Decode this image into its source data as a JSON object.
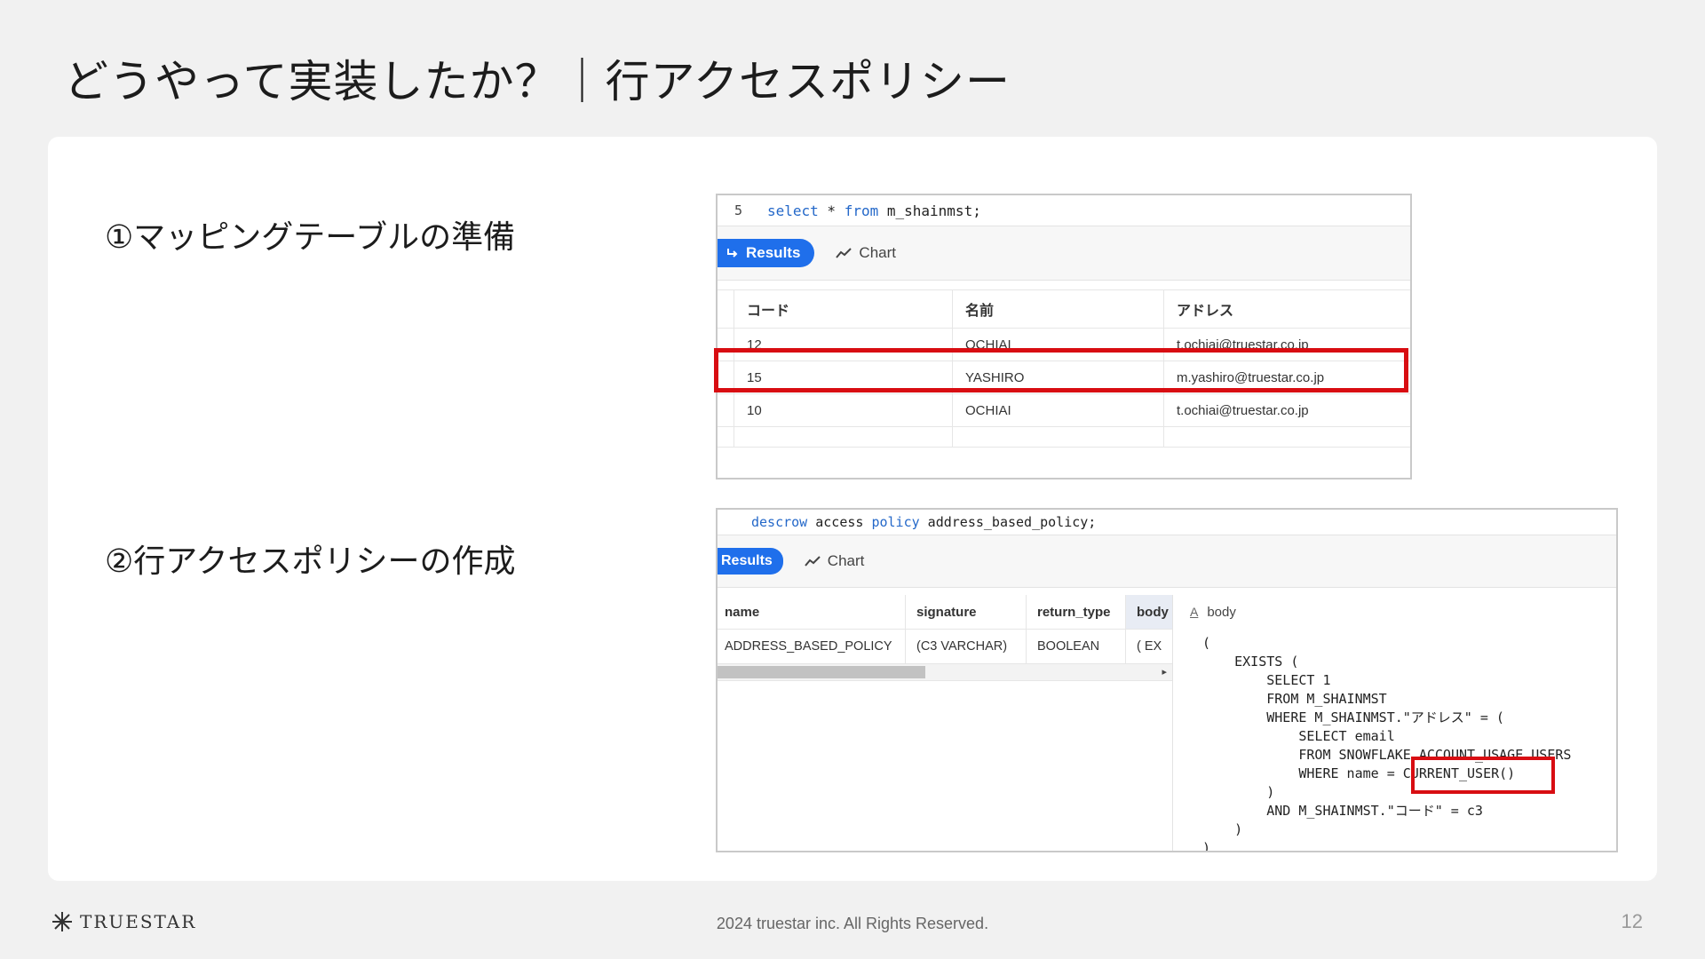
{
  "slide": {
    "title": "どうやって実装したか？｜行アクセスポリシー",
    "step1": "①マッピングテーブルの準備",
    "step2": "②行アクセスポリシーの作成"
  },
  "shot1": {
    "line_number": "5",
    "query_kw1": "select",
    "query_mid": " * ",
    "query_kw2": "from",
    "query_rest": " m_shainmst;",
    "results_tab": "Results",
    "chart_tab": "Chart",
    "columns": [
      "コード",
      "名前",
      "アドレス"
    ],
    "rows": [
      [
        "12",
        "OCHIAI",
        "t.ochiai@truestar.co.jp"
      ],
      [
        "15",
        "YASHIRO",
        "m.yashiro@truestar.co.jp"
      ],
      [
        "10",
        "OCHIAI",
        "t.ochiai@truestar.co.jp"
      ]
    ]
  },
  "shot2": {
    "query_kw1": "desc",
    "query_kw2": "row",
    "query_mid": " access ",
    "query_kw3": "policy",
    "query_rest": " address_based_policy;",
    "results_tab": "Results",
    "chart_tab": "Chart",
    "columns": [
      "name",
      "signature",
      "return_type",
      "body"
    ],
    "row": [
      "ADDRESS_BASED_POLICY",
      "(C3 VARCHAR)",
      "BOOLEAN",
      "(   EX"
    ],
    "body_label": "body",
    "body_code": "(\n    EXISTS (\n        SELECT 1\n        FROM M_SHAINMST\n        WHERE M_SHAINMST.\"アドレス\" = (\n            SELECT email\n            FROM SNOWFLAKE.ACCOUNT_USAGE.USERS\n            WHERE name = CURRENT_USER()\n        )\n        AND M_SHAINMST.\"コード\" = c3\n    )\n)"
  },
  "footer": {
    "logo_text": "TRUESTAR",
    "copyright": "2024 truestar inc. All Rights Reserved.",
    "page_number": "12"
  },
  "colors": {
    "accent_blue": "#1f6feb",
    "highlight_red": "#d80d12",
    "keyword_blue": "#2468c9"
  },
  "icons": [
    "arrow-return-icon",
    "chart-trend-icon",
    "text-type-icon",
    "scroll-right-icon",
    "truestar-logo-icon"
  ]
}
